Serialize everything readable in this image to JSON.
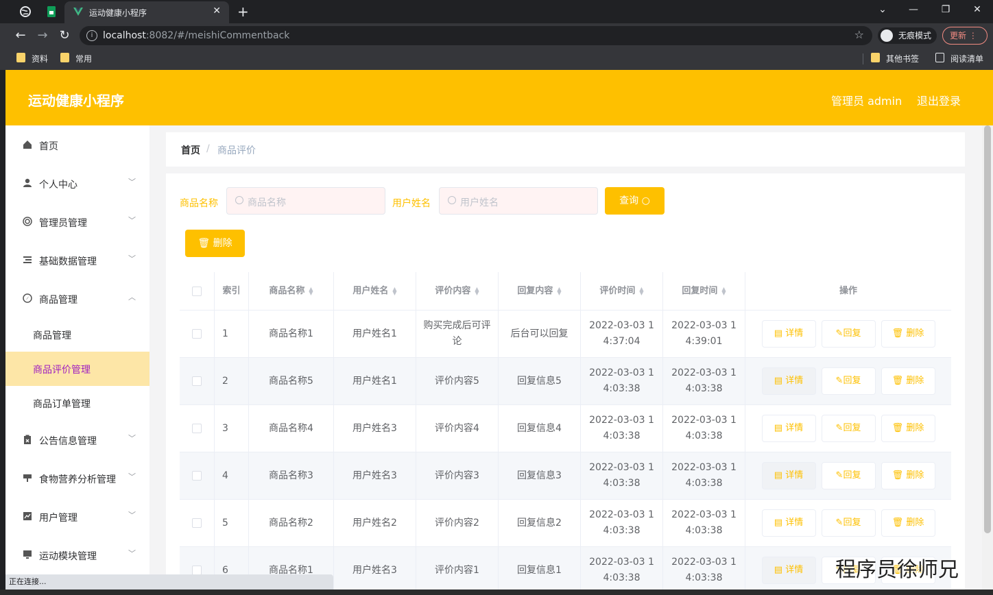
{
  "browser": {
    "tab_title": "运动健康小程序",
    "url_host": "localhost",
    "url_rest": ":8082/#/meishiCommentback",
    "incognito_label": "无痕模式",
    "update_label": "更新",
    "bookmarks": [
      "资料",
      "常用"
    ],
    "bookmarks_right": [
      "其他书签",
      "阅读清单"
    ],
    "status_text": "正在连接..."
  },
  "header": {
    "brand": "运动健康小程序",
    "admin_label": "管理员 admin",
    "logout_label": "退出登录"
  },
  "sidebar": {
    "items": [
      {
        "label": "首页",
        "icon": "home-icon"
      },
      {
        "label": "个人中心",
        "icon": "user-icon"
      },
      {
        "label": "管理员管理",
        "icon": "lifebuoy-icon"
      },
      {
        "label": "基础数据管理",
        "icon": "list-icon"
      },
      {
        "label": "商品管理",
        "icon": "compass-icon"
      },
      {
        "label": "公告信息管理",
        "icon": "clipboard-icon"
      },
      {
        "label": "食物营养分析管理",
        "icon": "cup-icon"
      },
      {
        "label": "用户管理",
        "icon": "chart-icon"
      },
      {
        "label": "运动模块管理",
        "icon": "monitor-icon"
      }
    ],
    "subitems": [
      "商品管理",
      "商品评价管理",
      "商品订单管理"
    ]
  },
  "breadcrumb": {
    "home": "首页",
    "separator": "/",
    "current": "商品评价"
  },
  "search": {
    "goods_label": "商品名称",
    "goods_placeholder": "商品名称",
    "user_label": "用户姓名",
    "user_placeholder": "用户姓名",
    "query_label": "查询",
    "delete_label": "删除"
  },
  "table": {
    "headers": [
      "索引",
      "商品名称",
      "用户姓名",
      "评价内容",
      "回复内容",
      "评价时间",
      "回复时间",
      "操作"
    ],
    "rows": [
      {
        "index": "1",
        "goods": "商品名称1",
        "user": "用户姓名1",
        "comment": "购买完成后可评论",
        "reply": "后台可以回复",
        "comment_time": "2022-03-03 14:37:04",
        "reply_time": "2022-03-03 14:39:01"
      },
      {
        "index": "2",
        "goods": "商品名称5",
        "user": "用户姓名1",
        "comment": "评价内容5",
        "reply": "回复信息5",
        "comment_time": "2022-03-03 14:03:38",
        "reply_time": "2022-03-03 14:03:38"
      },
      {
        "index": "3",
        "goods": "商品名称4",
        "user": "用户姓名3",
        "comment": "评价内容4",
        "reply": "回复信息4",
        "comment_time": "2022-03-03 14:03:38",
        "reply_time": "2022-03-03 14:03:38"
      },
      {
        "index": "4",
        "goods": "商品名称3",
        "user": "用户姓名3",
        "comment": "评价内容3",
        "reply": "回复信息3",
        "comment_time": "2022-03-03 14:03:38",
        "reply_time": "2022-03-03 14:03:38"
      },
      {
        "index": "5",
        "goods": "商品名称2",
        "user": "用户姓名2",
        "comment": "评价内容2",
        "reply": "回复信息2",
        "comment_time": "2022-03-03 14:03:38",
        "reply_time": "2022-03-03 14:03:38"
      },
      {
        "index": "6",
        "goods": "商品名称1",
        "user": "用户姓名3",
        "comment": "评价内容1",
        "reply": "回复信息1",
        "comment_time": "2022-03-03 14:03:38",
        "reply_time": "2022-03-03 14:03:38"
      }
    ],
    "actions": {
      "detail": "详情",
      "reply": "回复",
      "delete": "删除"
    }
  },
  "watermark": "程序员徐师兄",
  "colors": {
    "accent": "#fec000",
    "active_bg": "#fde6a7",
    "active_text": "#a020c0"
  }
}
